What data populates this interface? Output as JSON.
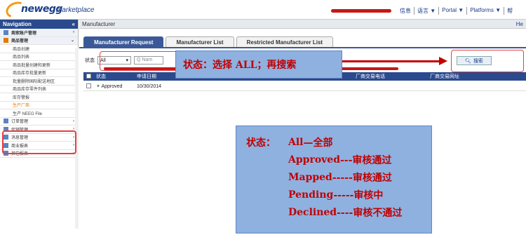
{
  "header": {
    "brand": "newegg",
    "brand_suffix": "marketplace",
    "links": [
      "信息",
      "语言 ▼",
      "Portal ▼",
      "Platforms ▼",
      "帮"
    ]
  },
  "sidebar": {
    "title": "Navigation",
    "collapse": "«",
    "items": [
      {
        "label": "商家账户管理",
        "type": "group"
      },
      {
        "label": "商品管理",
        "type": "group"
      },
      {
        "label": "商品创建",
        "type": "sub"
      },
      {
        "label": "商品列表",
        "type": "sub"
      },
      {
        "label": "商品批量创建和更新",
        "type": "sub"
      },
      {
        "label": "商品库存批量更新",
        "type": "sub"
      },
      {
        "label": "批量删除国际配送地区",
        "type": "sub"
      },
      {
        "label": "商品库存零件列表",
        "type": "sub"
      },
      {
        "label": "库存警报",
        "type": "sub"
      },
      {
        "label": "生产厂商",
        "type": "orange"
      },
      {
        "label": "生产 NEEG File",
        "type": "sub"
      },
      {
        "label": "订单管理",
        "type": "group2"
      },
      {
        "label": "促销管理",
        "type": "group2"
      },
      {
        "label": "消息管理",
        "type": "group2"
      },
      {
        "label": "商业报表",
        "type": "group2"
      },
      {
        "label": "其它报表",
        "type": "group2"
      }
    ]
  },
  "breadcrumb": {
    "title": "Manufacturer",
    "help": "He"
  },
  "tabs": [
    "Manufacturer Request",
    "Manufacturer List",
    "Restricted Manufacturer List"
  ],
  "filter": {
    "status_label": "状态",
    "status_value": "All",
    "search_placeholder": "Q Nam",
    "search_button": "搜索"
  },
  "grid": {
    "headers": [
      "状态",
      "申请日期",
      "",
      "厂商交易电话",
      "厂商交易网址"
    ],
    "rows": [
      {
        "status": "Approved",
        "date": "10/30/2014"
      }
    ]
  },
  "callout1": "状态：选择 ALL；再搜索",
  "callout2": {
    "title": "状态：",
    "lines": [
      {
        "key": "All",
        "text": "—全部"
      },
      {
        "key": "Approved",
        "text": "---审核通过"
      },
      {
        "key": "Mapped",
        "text": "-----审核通过"
      },
      {
        "key": "Pending",
        "text": "-----审核中"
      },
      {
        "key": "Declined",
        "text": "----审核不通过"
      }
    ]
  },
  "colors": {
    "nav_blue": "#2a4a8d",
    "callout_bg": "#8fb1e0",
    "callout_text": "#c00000"
  }
}
